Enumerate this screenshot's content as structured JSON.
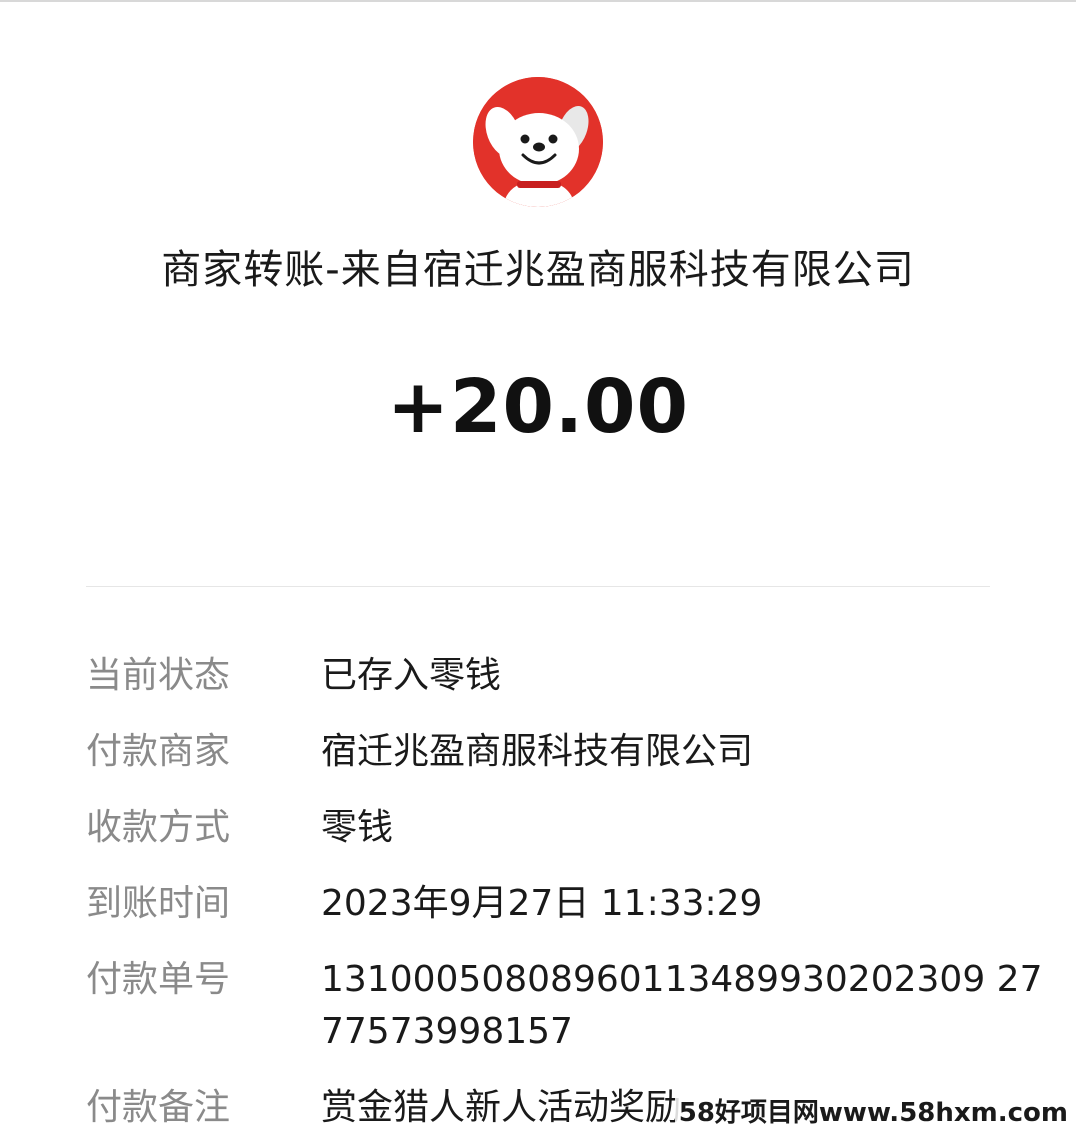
{
  "header": {
    "merchant_avatar_icon": "jd-dog-mascot-icon",
    "title": "商家转账-来自宿迁兆盈商服科技有限公司",
    "amount": "+20.00"
  },
  "details": {
    "status": {
      "label": "当前状态",
      "value": "已存入零钱"
    },
    "payer": {
      "label": "付款商家",
      "value": "宿迁兆盈商服科技有限公司"
    },
    "method": {
      "label": "收款方式",
      "value": "零钱"
    },
    "time": {
      "label": "到账时间",
      "value": "2023年9月27日 11:33:29"
    },
    "order_no": {
      "label": "付款单号",
      "value_line1": "13100050808960113489930202309 27",
      "value_line2": "77573998157"
    },
    "remark": {
      "label": "付款备注",
      "value": "赏金猎人新人活动奖励"
    }
  },
  "watermark": "58好项目网www.58hxm.com",
  "colors": {
    "avatar_bg": "#e2322a",
    "label": "#8a8a8a",
    "text": "#1a1a1a"
  }
}
